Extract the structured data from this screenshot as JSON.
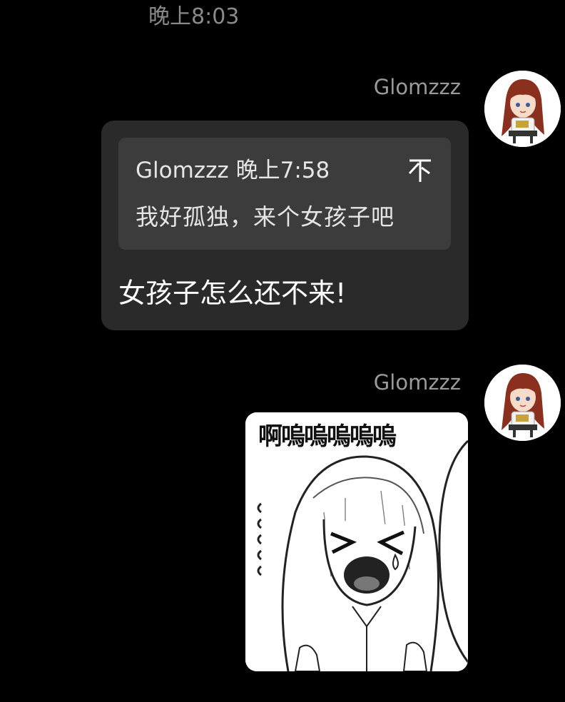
{
  "chat": {
    "timestamp": "晚上8:03",
    "messages": [
      {
        "sender": "Glomzzz",
        "reply": {
          "quoted_sender": "Glomzzz",
          "quoted_time": "晚上7:58",
          "quoted_text": "我好孤独，来个女孩子吧"
        },
        "text": "女孩子怎么还不来!"
      },
      {
        "sender": "Glomzzz",
        "sticker": {
          "caption": "啊嗚嗚嗚嗚嗚",
          "icon": "crying-anime-girl-sticker"
        }
      }
    ]
  },
  "colors": {
    "background": "#000000",
    "bubble": "#2a2a2a",
    "quote": "#3c3c3c",
    "muted_text": "#8a8a8a"
  },
  "icons": {
    "avatar": "anime-avatar-icon",
    "pin": "pin-to-top-icon"
  }
}
